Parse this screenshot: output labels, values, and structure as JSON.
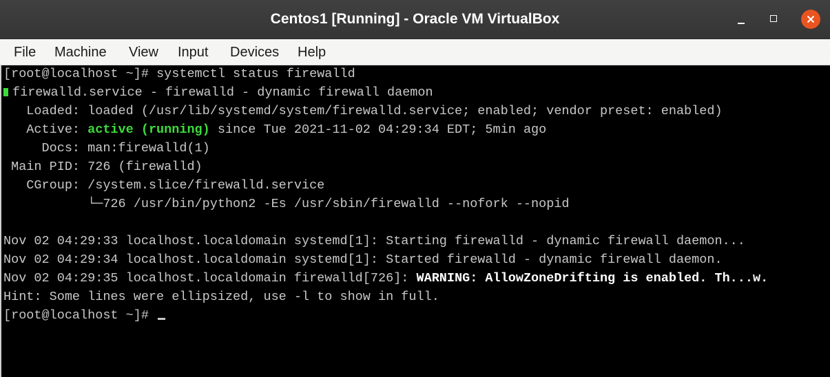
{
  "window": {
    "title": "Centos1 [Running] - Oracle VM VirtualBox",
    "buttons": {
      "minimize": "minimize-icon",
      "maximize": "maximize-icon",
      "close": "close-icon"
    },
    "accent_close": "#e95420"
  },
  "menu": {
    "file": "File",
    "machine": "Machine",
    "view": "View",
    "input": "Input",
    "devices": "Devices",
    "help": "Help"
  },
  "terminal": {
    "colors": {
      "background": "#000000",
      "text": "#c8c8c8",
      "active": "#3ddb3d",
      "warning": "#ffffff"
    },
    "cmd1": "[root@localhost ~]# systemctl status firewalld",
    "unit_line": "firewalld.service - firewalld - dynamic firewall daemon",
    "loaded_line": "   Loaded: loaded (/usr/lib/systemd/system/firewalld.service; enabled; vendor preset: enabled)",
    "active_prefix": "   Active: ",
    "active_state": "active (running)",
    "active_suffix": " since Tue 2021-11-02 04:29:34 EDT; 5min ago",
    "docs_line": "     Docs: man:firewalld(1)",
    "pid_line": " Main PID: 726 (firewalld)",
    "cgroup_line": "   CGroup: /system.slice/firewalld.service",
    "cgroup_child": "           └─726 /usr/bin/python2 -Es /usr/sbin/firewalld --nofork --nopid",
    "log1": "Nov 02 04:29:33 localhost.localdomain systemd[1]: Starting firewalld - dynamic firewall daemon...",
    "log2": "Nov 02 04:29:34 localhost.localdomain systemd[1]: Started firewalld - dynamic firewall daemon.",
    "log3_prefix": "Nov 02 04:29:35 localhost.localdomain firewalld[726]: ",
    "log3_warning": "WARNING: AllowZoneDrifting is enabled. Th...w.",
    "hint": "Hint: Some lines were ellipsized, use -l to show in full.",
    "prompt": "[root@localhost ~]# "
  }
}
